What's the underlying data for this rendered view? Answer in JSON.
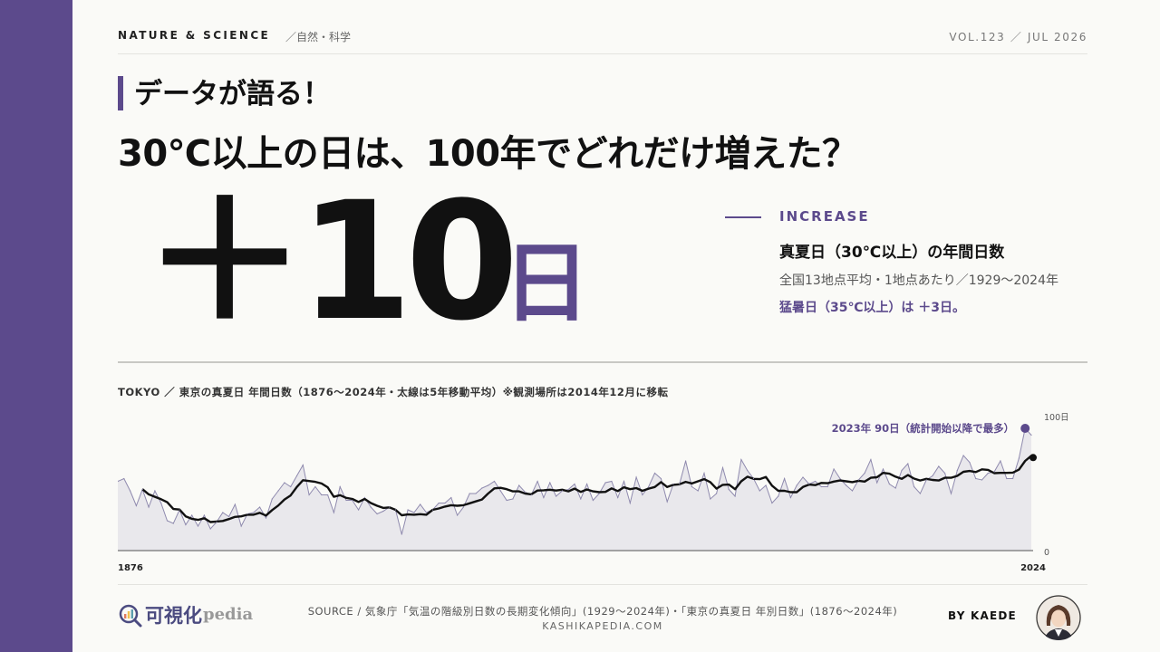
{
  "colors": {
    "accent": "#5c4a8c",
    "text": "#111111",
    "area_fill": "#e9e8ec",
    "annual_line": "#8f8aae",
    "baseline": "#888888"
  },
  "header": {
    "category": "NATURE & SCIENCE",
    "subcategory": "／自然・科学",
    "volume": "VOL.123 ／ JUL 2026"
  },
  "hero": {
    "kicker": "データが語る！",
    "headline": "30℃以上の日は、100年でどれだけ増えた？",
    "big_number": "＋10",
    "big_unit": "日"
  },
  "stat": {
    "label": "INCREASE",
    "title": "真夏日（30℃以上）の年間日数",
    "note": "全国13地点平均・1地点あたり／1929〜2024年",
    "extra": "猛暑日（35℃以上）は ＋3日。"
  },
  "chart_data": {
    "type": "area",
    "caption": "TOKYO ／ 東京の真夏日 年間日数（1876〜2024年・太線は5年移動平均）※観測場所は2014年12月に移転",
    "x_start_label": "1876",
    "x_end_label": "2024",
    "y_max_label": "100日",
    "y_min_label": "0",
    "ylim": [
      0,
      100
    ],
    "xlim": [
      1876,
      2024
    ],
    "grid": false,
    "annotation": "2023年 90日（統計開始以降で最多）",
    "highlight_year": 2023,
    "highlight_value": 90,
    "moving_average_window": 5,
    "x_start": 1876,
    "values": [
      51,
      53,
      44,
      33,
      45,
      32,
      44,
      35,
      22,
      20,
      30,
      19,
      26,
      18,
      26,
      16,
      21,
      28,
      25,
      34,
      18,
      27,
      28,
      32,
      24,
      38,
      44,
      50,
      47,
      55,
      63,
      41,
      47,
      41,
      41,
      28,
      47,
      37,
      37,
      30,
      39,
      32,
      27,
      29,
      32,
      30,
      12,
      30,
      28,
      34,
      28,
      30,
      35,
      35,
      39,
      26,
      32,
      42,
      42,
      46,
      48,
      51,
      44,
      37,
      38,
      48,
      43,
      41,
      51,
      39,
      50,
      40,
      44,
      45,
      49,
      38,
      49,
      37,
      42,
      50,
      51,
      39,
      51,
      35,
      54,
      41,
      47,
      57,
      53,
      36,
      49,
      49,
      66,
      47,
      44,
      57,
      38,
      42,
      61,
      45,
      40,
      67,
      59,
      53,
      44,
      48,
      35,
      40,
      53,
      39,
      48,
      54,
      49,
      51,
      47,
      47,
      60,
      53,
      48,
      44,
      52,
      57,
      67,
      50,
      60,
      49,
      46,
      59,
      64,
      47,
      42,
      52,
      55,
      62,
      57,
      42,
      59,
      70,
      65,
      53,
      52,
      57,
      58,
      66,
      53,
      53,
      68,
      90,
      85
    ]
  },
  "footer": {
    "logo_main": "可視化",
    "logo_suffix": "pedia",
    "source": "SOURCE / 気象庁「気温の階級別日数の長期変化傾向」(1929〜2024年)・「東京の真夏日 年別日数」(1876〜2024年)",
    "site": "KASHIKAPEDIA.COM",
    "byline": "BY KAEDE"
  }
}
